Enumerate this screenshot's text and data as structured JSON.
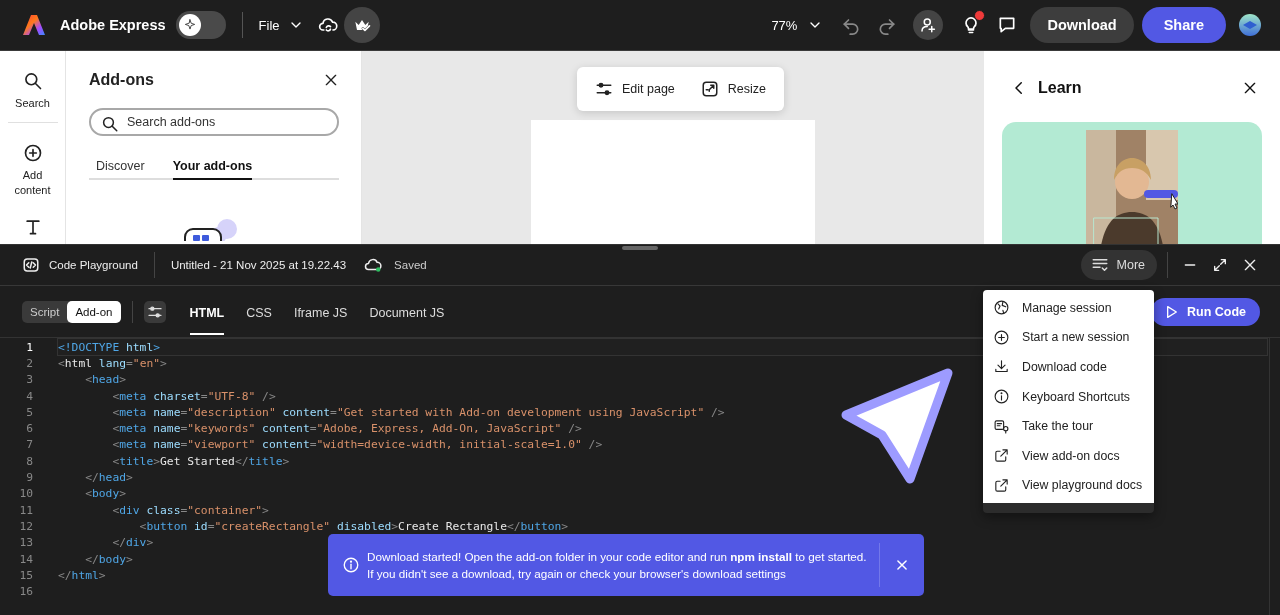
{
  "app": {
    "name": "Adobe Express",
    "ai_toggle": {
      "on": false
    },
    "file_menu": "File",
    "zoom": "77%",
    "ideas_unread": true,
    "download": "Download",
    "share": "Share"
  },
  "left_rail": {
    "items": [
      {
        "label": "Search"
      },
      {
        "label": "Add content"
      }
    ]
  },
  "addons_panel": {
    "title": "Add-ons",
    "search": {
      "placeholder": "Search add-ons"
    },
    "tabs": [
      {
        "label": "Discover",
        "selected": false
      },
      {
        "label": "Your add-ons",
        "selected": true
      }
    ]
  },
  "canvas": {
    "toolbar": [
      {
        "label": "Edit page"
      },
      {
        "label": "Resize"
      }
    ]
  },
  "learn_panel": {
    "title": "Learn"
  },
  "playground": {
    "title": "Code Playground",
    "document": "Untitled - 21 Nov 2025 at 19.22.43",
    "save_status": "Saved",
    "more": "More",
    "modes": [
      {
        "label": "Script",
        "selected": false
      },
      {
        "label": "Add-on",
        "selected": true
      }
    ],
    "tabs": [
      {
        "label": "HTML",
        "selected": true
      },
      {
        "label": "CSS",
        "selected": false
      },
      {
        "label": "Iframe JS",
        "selected": false
      },
      {
        "label": "Document JS",
        "selected": false
      }
    ],
    "run": "Run Code",
    "lines": [
      {
        "number": "1",
        "active": true,
        "tokens": [
          {
            "kind": "tag",
            "text": "<!DOCTYPE"
          },
          {
            "kind": "attr",
            "text": " html"
          },
          {
            "kind": "tag",
            "text": ">"
          }
        ]
      },
      {
        "number": "2",
        "active": false,
        "tokens": [
          {
            "kind": "punct",
            "text": "<"
          },
          {
            "kind": "text",
            "text": "html"
          },
          {
            "kind": "attr",
            "text": " lang"
          },
          {
            "kind": "punct",
            "text": "="
          },
          {
            "kind": "string",
            "text": "\"en\""
          },
          {
            "kind": "punct",
            "text": ">"
          }
        ]
      },
      {
        "number": "3",
        "active": false,
        "tokens": [
          {
            "kind": "punct",
            "text": "    <"
          },
          {
            "kind": "tag",
            "text": "head"
          },
          {
            "kind": "punct",
            "text": ">"
          }
        ]
      },
      {
        "number": "4",
        "active": false,
        "tokens": [
          {
            "kind": "punct",
            "text": "        <"
          },
          {
            "kind": "tag",
            "text": "meta"
          },
          {
            "kind": "attr",
            "text": " charset"
          },
          {
            "kind": "punct",
            "text": "="
          },
          {
            "kind": "string",
            "text": "\"UTF-8\""
          },
          {
            "kind": "punct",
            "text": " />"
          }
        ]
      },
      {
        "number": "5",
        "active": false,
        "tokens": [
          {
            "kind": "punct",
            "text": "        <"
          },
          {
            "kind": "tag",
            "text": "meta"
          },
          {
            "kind": "attr",
            "text": " name"
          },
          {
            "kind": "punct",
            "text": "="
          },
          {
            "kind": "string",
            "text": "\"description\""
          },
          {
            "kind": "attr",
            "text": " content"
          },
          {
            "kind": "punct",
            "text": "="
          },
          {
            "kind": "string",
            "text": "\"Get started with Add-on development using JavaScript\""
          },
          {
            "kind": "punct",
            "text": " />"
          }
        ]
      },
      {
        "number": "6",
        "active": false,
        "tokens": [
          {
            "kind": "punct",
            "text": "        <"
          },
          {
            "kind": "tag",
            "text": "meta"
          },
          {
            "kind": "attr",
            "text": " name"
          },
          {
            "kind": "punct",
            "text": "="
          },
          {
            "kind": "string",
            "text": "\"keywords\""
          },
          {
            "kind": "attr",
            "text": " content"
          },
          {
            "kind": "punct",
            "text": "="
          },
          {
            "kind": "string",
            "text": "\"Adobe, Express, Add-On, JavaScript\""
          },
          {
            "kind": "punct",
            "text": " />"
          }
        ]
      },
      {
        "number": "7",
        "active": false,
        "tokens": [
          {
            "kind": "punct",
            "text": "        <"
          },
          {
            "kind": "tag",
            "text": "meta"
          },
          {
            "kind": "attr",
            "text": " name"
          },
          {
            "kind": "punct",
            "text": "="
          },
          {
            "kind": "string",
            "text": "\"viewport\""
          },
          {
            "kind": "attr",
            "text": " content"
          },
          {
            "kind": "punct",
            "text": "="
          },
          {
            "kind": "string",
            "text": "\"width=device-width, initial-scale=1.0\""
          },
          {
            "kind": "punct",
            "text": " />"
          }
        ]
      },
      {
        "number": "8",
        "active": false,
        "tokens": [
          {
            "kind": "punct",
            "text": "        <"
          },
          {
            "kind": "tag",
            "text": "title"
          },
          {
            "kind": "punct",
            "text": ">"
          },
          {
            "kind": "text",
            "text": "Get Started"
          },
          {
            "kind": "punct",
            "text": "</"
          },
          {
            "kind": "tag",
            "text": "title"
          },
          {
            "kind": "punct",
            "text": ">"
          }
        ]
      },
      {
        "number": "9",
        "active": false,
        "tokens": [
          {
            "kind": "punct",
            "text": "    </"
          },
          {
            "kind": "tag",
            "text": "head"
          },
          {
            "kind": "punct",
            "text": ">"
          }
        ]
      },
      {
        "number": "10",
        "active": false,
        "tokens": [
          {
            "kind": "punct",
            "text": "    <"
          },
          {
            "kind": "tag",
            "text": "body"
          },
          {
            "kind": "punct",
            "text": ">"
          }
        ]
      },
      {
        "number": "11",
        "active": false,
        "tokens": [
          {
            "kind": "punct",
            "text": "        <"
          },
          {
            "kind": "tag",
            "text": "div"
          },
          {
            "kind": "attr",
            "text": " class"
          },
          {
            "kind": "punct",
            "text": "="
          },
          {
            "kind": "string",
            "text": "\"container\""
          },
          {
            "kind": "punct",
            "text": ">"
          }
        ]
      },
      {
        "number": "12",
        "active": false,
        "tokens": [
          {
            "kind": "punct",
            "text": "            <"
          },
          {
            "kind": "tag",
            "text": "button"
          },
          {
            "kind": "attr",
            "text": " id"
          },
          {
            "kind": "punct",
            "text": "="
          },
          {
            "kind": "string",
            "text": "\"createRectangle\""
          },
          {
            "kind": "attr",
            "text": " disabled"
          },
          {
            "kind": "punct",
            "text": ">"
          },
          {
            "kind": "text",
            "text": "Create Rectangle"
          },
          {
            "kind": "punct",
            "text": "</"
          },
          {
            "kind": "tag",
            "text": "button"
          },
          {
            "kind": "punct",
            "text": ">"
          }
        ]
      },
      {
        "number": "13",
        "active": false,
        "tokens": [
          {
            "kind": "punct",
            "text": "        </"
          },
          {
            "kind": "tag",
            "text": "div"
          },
          {
            "kind": "punct",
            "text": ">"
          }
        ]
      },
      {
        "number": "14",
        "active": false,
        "tokens": [
          {
            "kind": "punct",
            "text": "    </"
          },
          {
            "kind": "tag",
            "text": "body"
          },
          {
            "kind": "punct",
            "text": ">"
          }
        ]
      },
      {
        "number": "15",
        "active": false,
        "tokens": [
          {
            "kind": "punct",
            "text": "</"
          },
          {
            "kind": "tag",
            "text": "html"
          },
          {
            "kind": "punct",
            "text": ">"
          }
        ]
      },
      {
        "number": "16",
        "active": false
      }
    ]
  },
  "more_menu": {
    "items": [
      {
        "label": "Manage session"
      },
      {
        "label": "Start a new session"
      },
      {
        "label": "Download code"
      },
      {
        "label": "Keyboard Shortcuts"
      },
      {
        "label": "Take the tour"
      },
      {
        "label": "View add-on docs"
      },
      {
        "label": "View playground docs"
      }
    ]
  },
  "toast": {
    "lines": [
      "Download started! Open the add-on folder in your code editor and run **npm install** to get started.",
      "If you didn't see a download, try again or check your browser's download settings"
    ]
  }
}
